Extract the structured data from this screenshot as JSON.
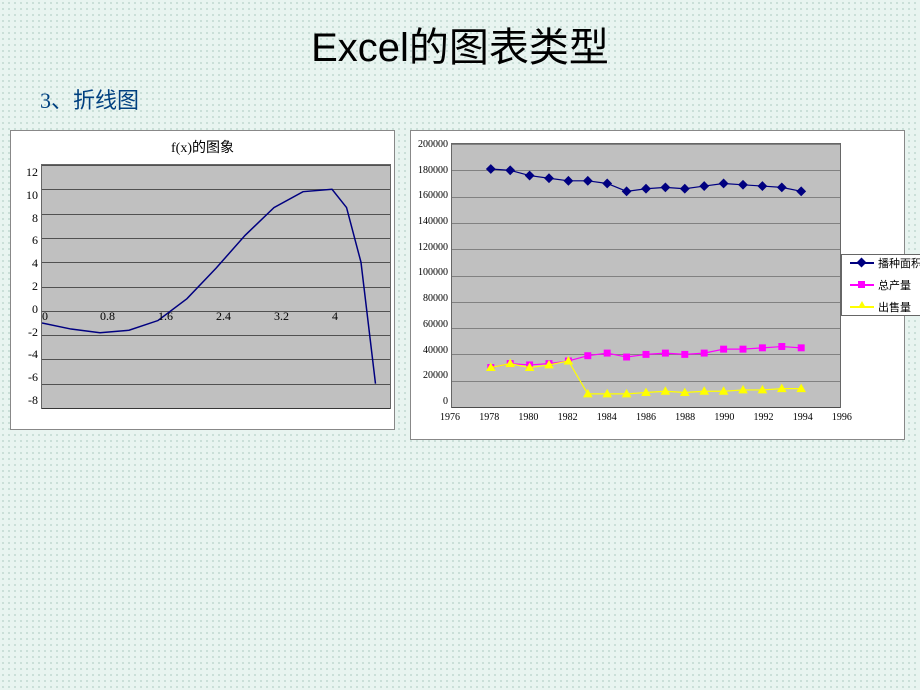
{
  "page": {
    "title": "Excel的图表类型",
    "subtitle": "3、折线图"
  },
  "chart_data": [
    {
      "type": "line",
      "title": "f(x)的图象",
      "xlabel": "",
      "ylabel": "",
      "xlim": [
        0,
        4.8
      ],
      "ylim": [
        -8,
        12
      ],
      "x_ticks": [
        "0",
        "0.8",
        "1.6",
        "2.4",
        "3.2",
        "4"
      ],
      "y_ticks": [
        "12",
        "10",
        "8",
        "6",
        "4",
        "2",
        "0",
        "-2",
        "-4",
        "-6",
        "-8"
      ],
      "x": [
        0,
        0.4,
        0.8,
        1.2,
        1.6,
        2.0,
        2.4,
        2.8,
        3.2,
        3.6,
        4.0,
        4.2,
        4.4,
        4.6
      ],
      "values": [
        -1.0,
        -1.5,
        -1.8,
        -1.6,
        -0.8,
        1.0,
        3.5,
        6.2,
        8.5,
        9.8,
        10.0,
        8.5,
        4.0,
        -6.0
      ]
    },
    {
      "type": "line",
      "title": "",
      "xlabel": "",
      "ylabel": "",
      "xlim": [
        1976,
        1996
      ],
      "ylim": [
        0,
        200000
      ],
      "x_ticks": [
        "1976",
        "1978",
        "1980",
        "1982",
        "1984",
        "1986",
        "1988",
        "1990",
        "1992",
        "1994",
        "1996"
      ],
      "y_ticks": [
        "200000",
        "180000",
        "160000",
        "140000",
        "120000",
        "100000",
        "80000",
        "60000",
        "40000",
        "20000",
        "0"
      ],
      "categories": [
        1978,
        1979,
        1980,
        1981,
        1982,
        1983,
        1984,
        1985,
        1986,
        1987,
        1988,
        1989,
        1990,
        1991,
        1992,
        1993,
        1994
      ],
      "series": [
        {
          "name": "播种面积",
          "color": "#000080",
          "marker": "diamond",
          "values": [
            181000,
            180000,
            176000,
            174000,
            172000,
            172000,
            170000,
            164000,
            166000,
            167000,
            166000,
            168000,
            170000,
            169000,
            168000,
            167000,
            164000
          ]
        },
        {
          "name": "总产量",
          "color": "#ff00ff",
          "marker": "square",
          "values": [
            30000,
            33000,
            32000,
            33000,
            35000,
            39000,
            41000,
            38000,
            40000,
            41000,
            40000,
            41000,
            44000,
            44000,
            45000,
            46000,
            45000
          ]
        },
        {
          "name": "出售量",
          "color": "#ffff00",
          "marker": "triangle",
          "values": [
            30000,
            33000,
            30000,
            32000,
            35000,
            10000,
            10000,
            10000,
            11000,
            12000,
            11000,
            12000,
            12000,
            13000,
            13000,
            14000,
            14000
          ]
        }
      ]
    }
  ]
}
